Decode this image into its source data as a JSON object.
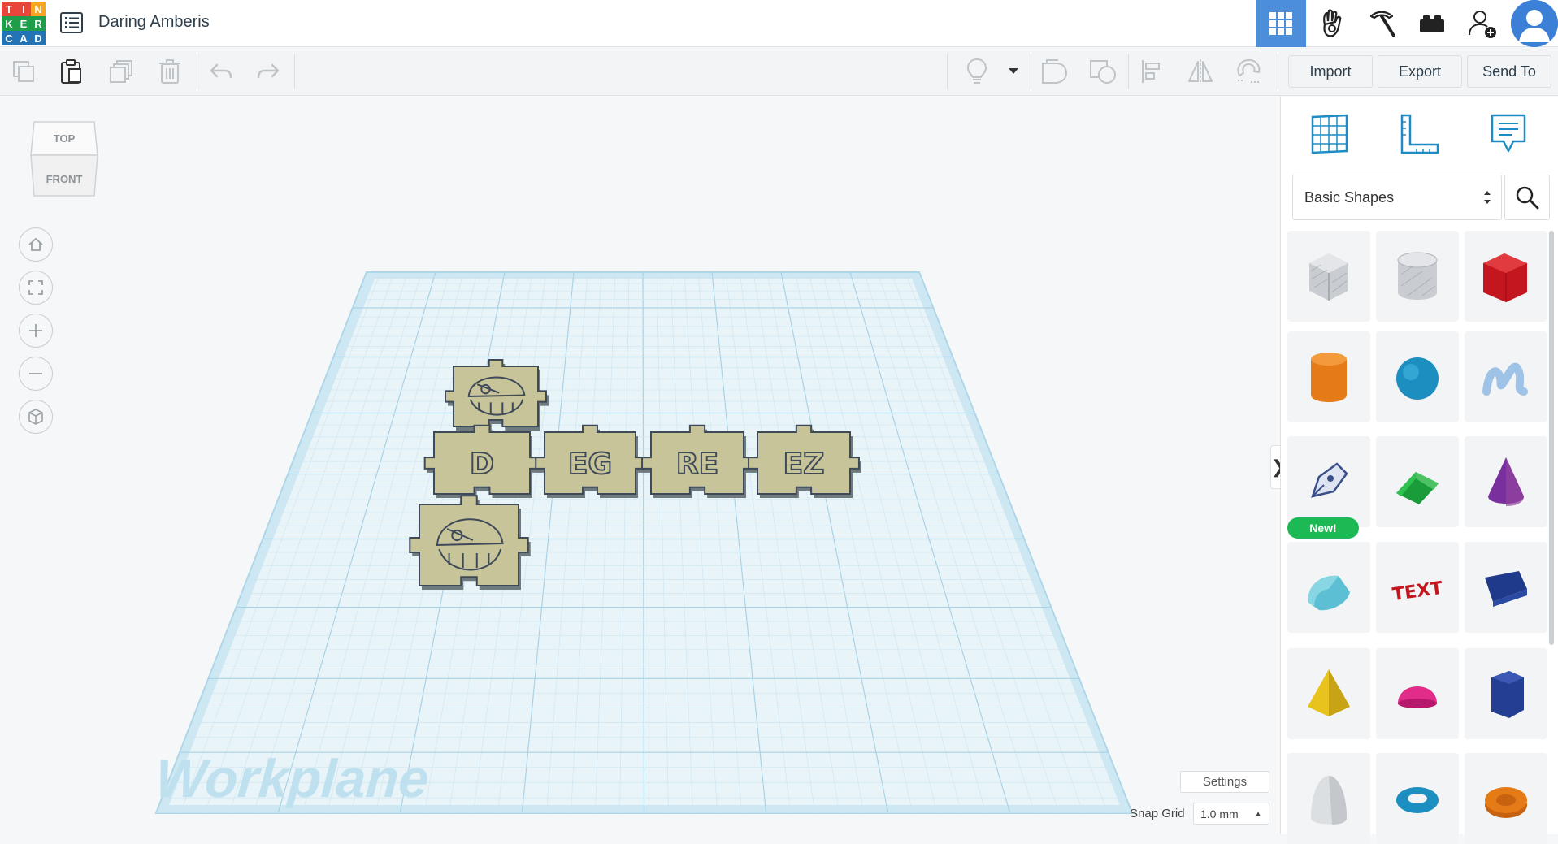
{
  "app": {
    "logo_letters": [
      "T",
      "I",
      "N",
      "K",
      "E",
      "R",
      "C",
      "A",
      "D"
    ],
    "logo_colors": [
      "#e8463a",
      "#e8463a",
      "#f6a623",
      "#1e9e4a",
      "#1e9e4a",
      "#1e9e4a",
      "#2473b4",
      "#2473b4",
      "#2473b4"
    ],
    "design_title": "Daring Amberis"
  },
  "header_icons": [
    "grid-view-icon",
    "hand-sim-icon",
    "pickaxe-icon",
    "bricks-icon",
    "add-user-icon",
    "profile-avatar-icon"
  ],
  "toolbar": {
    "import_label": "Import",
    "export_label": "Export",
    "send_to_label": "Send To"
  },
  "viewcube": {
    "top_label": "TOP",
    "front_label": "FRONT"
  },
  "workplane": {
    "label": "Workplane",
    "pieces": [
      {
        "label": "",
        "kind": "face"
      },
      {
        "label": "D",
        "kind": "letter"
      },
      {
        "label": "EG",
        "kind": "letter"
      },
      {
        "label": "RE",
        "kind": "letter"
      },
      {
        "label": "EZ",
        "kind": "letter"
      },
      {
        "label": "",
        "kind": "face"
      }
    ]
  },
  "sidebar": {
    "category": "Basic Shapes",
    "new_badge": "New!",
    "shapes": [
      "box",
      "cylinder-hole",
      "box-red",
      "cylinder",
      "sphere",
      "scribble",
      "sketch-pen",
      "roof",
      "cone",
      "round-roof",
      "text",
      "wedge",
      "pyramid",
      "half-sphere",
      "polygon",
      "paraboloid",
      "torus",
      "tube"
    ]
  },
  "bottom": {
    "settings_label": "Settings",
    "snap_grid_label": "Snap Grid",
    "snap_grid_value": "1.0 mm"
  },
  "colors": {
    "accent": "#4c8ed9",
    "grid": "#cfe6f1",
    "pieces": "#c8c49a",
    "pieces_stroke": "#3e4a58"
  }
}
